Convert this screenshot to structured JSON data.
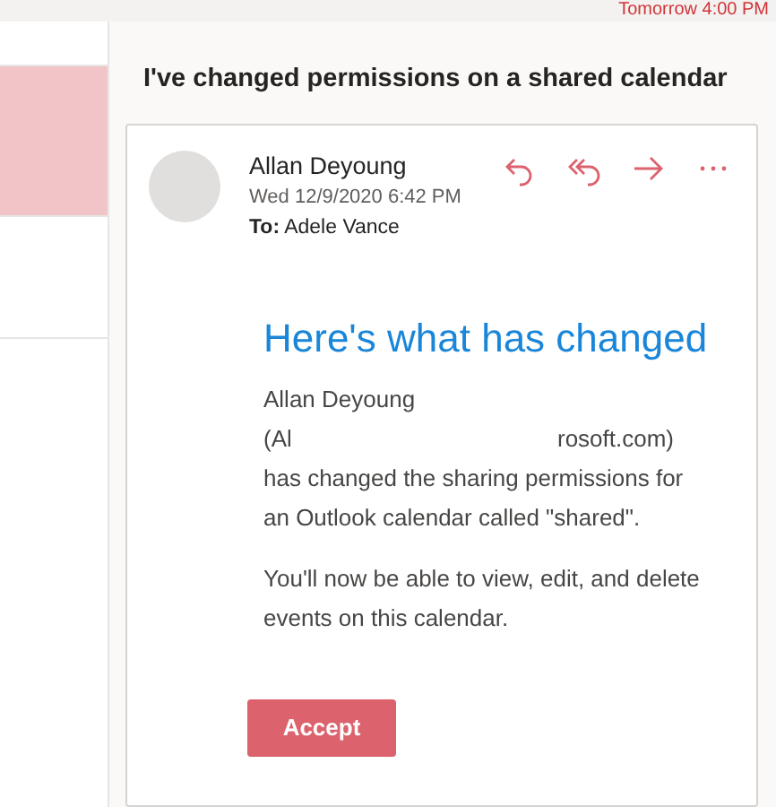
{
  "top_bar": {
    "reminder": "Tomorrow 4:00 PM"
  },
  "message_list": [
    {
      "selected": false
    },
    {
      "selected": true
    },
    {
      "selected": false
    }
  ],
  "reading_pane": {
    "subject": "I've changed permissions on a shared calendar",
    "message": {
      "sender": "Allan Deyoung",
      "date": "Wed 12/9/2020 6:42 PM",
      "to_label": "To:",
      "to": "Adele Vance",
      "actions": [
        {
          "kind": "reply"
        },
        {
          "kind": "reply_all"
        },
        {
          "kind": "forward"
        },
        {
          "kind": "more"
        }
      ],
      "heading": "Here's what has changed",
      "body_name": "Allan Deyoung",
      "address_start": "(Al",
      "address_end": "rosoft.com)",
      "body_lines": [
        "has changed the sharing permissions for an Outlook calendar called \"shared\".",
        "You'll now be able to view, edit, and delete events on this calendar."
      ],
      "button": "Accept"
    }
  }
}
